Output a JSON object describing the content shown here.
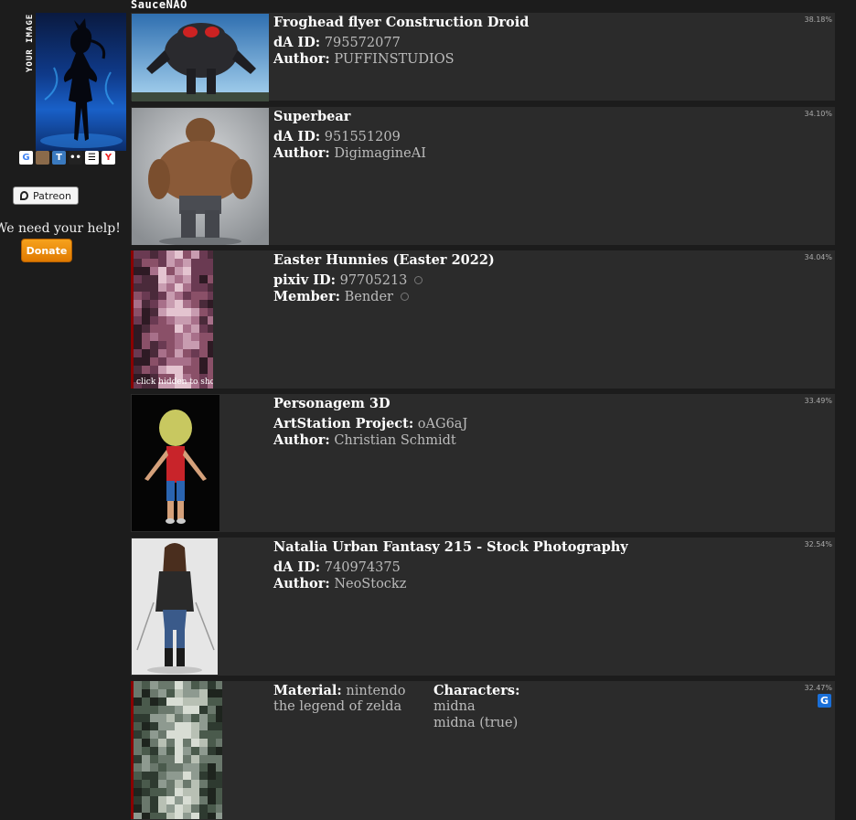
{
  "app": {
    "logo": "SauceNAO"
  },
  "sidebar": {
    "your_image_label": "YOUR IMAGE",
    "search_icons": [
      {
        "name": "google",
        "glyph": "G",
        "fg": "#4285f4",
        "bg": "#ffffff"
      },
      {
        "name": "ascii2d",
        "glyph": "",
        "fg": "#fff",
        "bg": "#8a6a4a"
      },
      {
        "name": "tineye",
        "glyph": "T",
        "fg": "#fff",
        "bg": "#3a7abf"
      },
      {
        "name": "iqdb",
        "glyph": "••",
        "fg": "#fff",
        "bg": "#222"
      },
      {
        "name": "trace",
        "glyph": "☰",
        "fg": "#000",
        "bg": "#fff"
      },
      {
        "name": "yandex",
        "glyph": "Y",
        "fg": "#e22",
        "bg": "#fff"
      }
    ],
    "patreon_label": "Patreon",
    "help_text": "We need your help!",
    "donate_label": "Donate"
  },
  "results": [
    {
      "similarity": "38.18%",
      "title": "Froghead flyer Construction Droid",
      "lines": [
        {
          "label": "dA ID:",
          "value": "795572077"
        },
        {
          "label": "Author:",
          "value": "PUFFINSTUDIOS"
        }
      ]
    },
    {
      "similarity": "34.10%",
      "title": "Superbear",
      "lines": [
        {
          "label": "dA ID:",
          "value": "951551209"
        },
        {
          "label": "Author:",
          "value": "DigimagineAI"
        }
      ]
    },
    {
      "similarity": "34.04%",
      "title": "Easter Hunnies (Easter 2022)",
      "hidden_note": "click hidden to show",
      "lines": [
        {
          "label": "pixiv ID:",
          "value": "97705213"
        },
        {
          "label": "Member:",
          "value": "Bender"
        }
      ]
    },
    {
      "similarity": "33.49%",
      "title": "Personagem 3D",
      "lines": [
        {
          "label": "ArtStation Project:",
          "value": "oAG6aJ"
        },
        {
          "label": "Author:",
          "value": "Christian Schmidt"
        }
      ]
    },
    {
      "similarity": "32.54%",
      "title": "Natalia Urban Fantasy 215 - Stock Photography",
      "lines": [
        {
          "label": "dA ID:",
          "value": "740974375"
        },
        {
          "label": "Author:",
          "value": "NeoStockz"
        }
      ]
    },
    {
      "similarity": "32.47%",
      "material_label": "Material:",
      "material_values": [
        "nintendo",
        "the legend of zelda"
      ],
      "characters_label": "Characters:",
      "characters_values": [
        "midna",
        "midna (true)"
      ],
      "source_icon": "G"
    }
  ]
}
